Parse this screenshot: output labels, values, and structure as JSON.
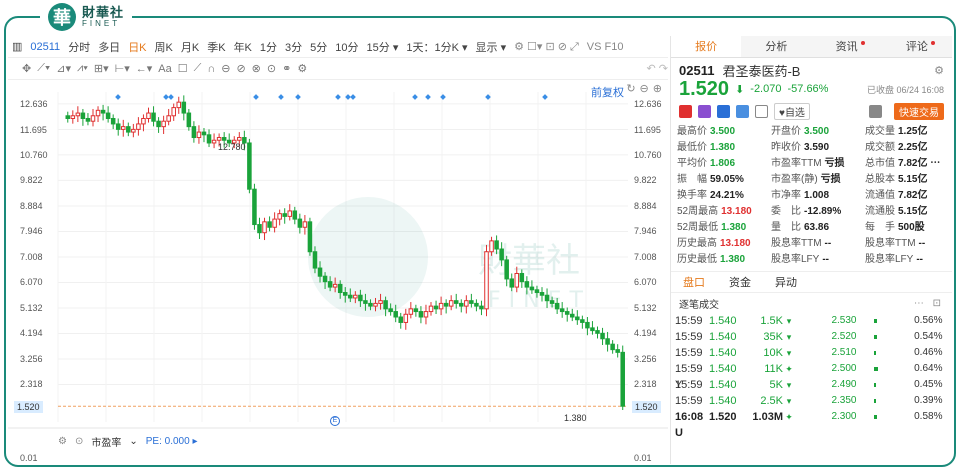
{
  "brand": {
    "cn": "財華社",
    "en": "FINET",
    "mark": "華"
  },
  "toolbar1": [
    "分时",
    "多日",
    "日K",
    "周K",
    "月K",
    "季K",
    "年K",
    "1分",
    "3分",
    "5分",
    "10分",
    "15分 ▾",
    "1天：1分K ▾",
    "显示 ▾"
  ],
  "toolbar1_active": "日K",
  "toolbar1_right": "VS F10",
  "stock": {
    "code": "02511",
    "name": "君圣泰医药-B",
    "price": "1.520",
    "arrow": "⬇",
    "change": "-2.070",
    "change_pct": "-57.66%",
    "closed_label": "已收盘 06/24 16:08"
  },
  "chart": {
    "fuquan": "前复权",
    "y_ticks": [
      "12.636",
      "11.695",
      "10.760",
      "9.822",
      "8.884",
      "7.946",
      "7.008",
      "6.070",
      "5.132",
      "4.194",
      "3.256",
      "2.318"
    ],
    "current": "1.520",
    "high_label": "12.780",
    "low_label": "1.380",
    "ratio_label": "市盈率",
    "pe_label": "PE: 0.000 ▸",
    "bottom_tick": "0.01",
    "watermark": "財華社",
    "watermark_en": "FINET"
  },
  "chart_data": {
    "type": "candlestick",
    "title": "",
    "ylabel": "",
    "ylim": [
      1.38,
      12.78
    ],
    "series": [
      {
        "values": [
          12.1,
          12.2,
          12.3,
          12.1,
          12.0,
          12.2,
          12.4,
          12.3,
          12.1,
          11.9,
          11.7,
          11.8,
          11.6,
          11.7,
          11.9,
          12.1,
          12.3,
          12.0,
          11.8,
          12.0,
          12.2,
          12.5,
          12.7,
          12.3,
          11.8,
          11.4,
          11.6,
          11.5,
          11.2,
          11.3,
          11.4,
          11.3,
          11.2,
          11.3,
          11.4,
          11.2,
          9.5,
          8.2,
          7.9,
          8.3,
          8.1,
          8.4,
          8.6,
          8.5,
          8.7,
          8.4,
          8.1,
          8.3,
          7.2,
          6.6,
          6.3,
          6.1,
          5.9,
          6.0,
          5.7,
          5.6,
          5.5,
          5.6,
          5.4,
          5.3,
          5.2,
          5.3,
          5.4,
          5.1,
          5.0,
          4.8,
          4.6,
          4.9,
          5.1,
          5.0,
          4.8,
          5.0,
          5.2,
          5.1,
          5.3,
          5.2,
          5.4,
          5.3,
          5.2,
          5.4,
          5.3,
          5.2,
          5.1,
          7.2,
          7.6,
          7.3,
          6.9,
          6.2,
          5.9,
          6.4,
          6.1,
          5.9,
          5.8,
          5.7,
          5.6,
          5.4,
          5.3,
          5.1,
          5.0,
          4.9,
          4.8,
          4.7,
          4.6,
          4.4,
          4.3,
          4.2,
          4.0,
          3.8,
          3.6,
          3.5,
          1.52
        ]
      }
    ]
  },
  "right": {
    "tabs": [
      "报价",
      "分析",
      "资讯",
      "评论"
    ],
    "buttons": {
      "mark": "♥自选",
      "trade": "快速交易"
    },
    "stats": [
      [
        "最高价",
        "3.500",
        "g"
      ],
      [
        "开盘价",
        "3.500",
        "g"
      ],
      [
        "成交量",
        "1.25亿",
        ""
      ],
      [
        "最低价",
        "1.380",
        "g"
      ],
      [
        "昨收价",
        "3.590",
        ""
      ],
      [
        "成交额",
        "2.25亿",
        ""
      ],
      [
        "平均价",
        "1.806",
        "g"
      ],
      [
        "市盈率TTM",
        "亏损",
        ""
      ],
      [
        "总市值",
        "7.82亿 ⋯",
        ""
      ],
      [
        "振　幅",
        "59.05%",
        ""
      ],
      [
        "市盈率(静)",
        "亏损",
        ""
      ],
      [
        "总股本",
        "5.15亿",
        ""
      ],
      [
        "换手率",
        "24.21%",
        ""
      ],
      [
        "市净率",
        "1.008",
        ""
      ],
      [
        "流通值",
        "7.82亿",
        ""
      ],
      [
        "52周最高",
        "13.180",
        "r"
      ],
      [
        "委　比",
        "-12.89%",
        ""
      ],
      [
        "流通股",
        "5.15亿",
        ""
      ],
      [
        "52周最低",
        "1.380",
        "g"
      ],
      [
        "量　比",
        "63.86",
        ""
      ],
      [
        "每　手",
        "500股",
        ""
      ],
      [
        "历史最高",
        "13.180",
        "r"
      ],
      [
        "股息率TTM",
        "--",
        ""
      ],
      [
        "股息率TTM",
        "--",
        ""
      ],
      [
        "历史最低",
        "1.380",
        "g"
      ],
      [
        "股息率LFY",
        "--",
        ""
      ],
      [
        "股息率LFY",
        "--",
        ""
      ]
    ],
    "subtabs": [
      "盘口",
      "资金",
      "异动"
    ],
    "ticks_title": "逐笔成交",
    "ticks": [
      {
        "t": "15:59",
        "p": "1.540",
        "v": "1.5K",
        "d": "▾"
      },
      {
        "t": "15:59",
        "p": "1.540",
        "v": "35K",
        "d": "▾"
      },
      {
        "t": "15:59",
        "p": "1.540",
        "v": "10K",
        "d": "▾"
      },
      {
        "t": "15:59 Y",
        "p": "1.540",
        "v": "11K",
        "d": "✦"
      },
      {
        "t": "15:59",
        "p": "1.540",
        "v": "5K",
        "d": "▾"
      },
      {
        "t": "15:59",
        "p": "1.540",
        "v": "2.5K",
        "d": "▾"
      },
      {
        "t": "16:08 U",
        "p": "1.520",
        "v": "1.03M",
        "d": "✦"
      }
    ],
    "depth": [
      {
        "p": "2.530",
        "pct": "0.56%",
        "w": 3
      },
      {
        "p": "2.520",
        "pct": "0.54%",
        "w": 3
      },
      {
        "p": "2.510",
        "pct": "0.46%",
        "w": 2
      },
      {
        "p": "2.500",
        "pct": "0.64%",
        "w": 4
      },
      {
        "p": "2.490",
        "pct": "0.45%",
        "w": 2
      },
      {
        "p": "2.350",
        "pct": "0.39%",
        "w": 2
      },
      {
        "p": "2.300",
        "pct": "0.58%",
        "w": 3
      }
    ]
  }
}
